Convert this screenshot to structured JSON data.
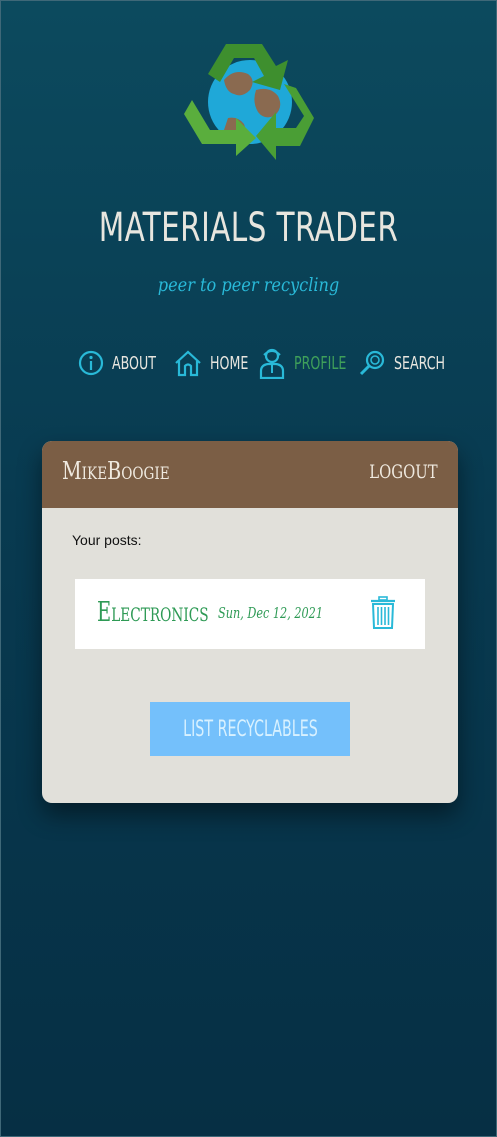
{
  "app": {
    "title": "MATERIALS TRADER",
    "subtitle": "peer to peer recycling"
  },
  "nav": {
    "items": [
      {
        "label": "ABOUT",
        "icon": "info-icon"
      },
      {
        "label": "HOME",
        "icon": "home-icon"
      },
      {
        "label": "PROFILE",
        "icon": "user-icon",
        "active": true
      },
      {
        "label": "SEARCH",
        "icon": "magnifier-icon"
      }
    ]
  },
  "profile": {
    "username": "MikeBoogie",
    "logout_label": "LOGOUT",
    "posts_label": "Your posts:",
    "posts": [
      {
        "title": "Electronics",
        "date": "Sun, Dec 12, 2021",
        "delete_icon": "trash-icon"
      }
    ],
    "list_button_label": "LIST RECYCLABLES"
  },
  "colors": {
    "background": "#083a50",
    "card_header": "#7b5e45",
    "card_body": "#e1e0da",
    "accent_green": "#2e9a55",
    "accent_cyan": "#29b9d8",
    "button": "#74c0fb"
  }
}
